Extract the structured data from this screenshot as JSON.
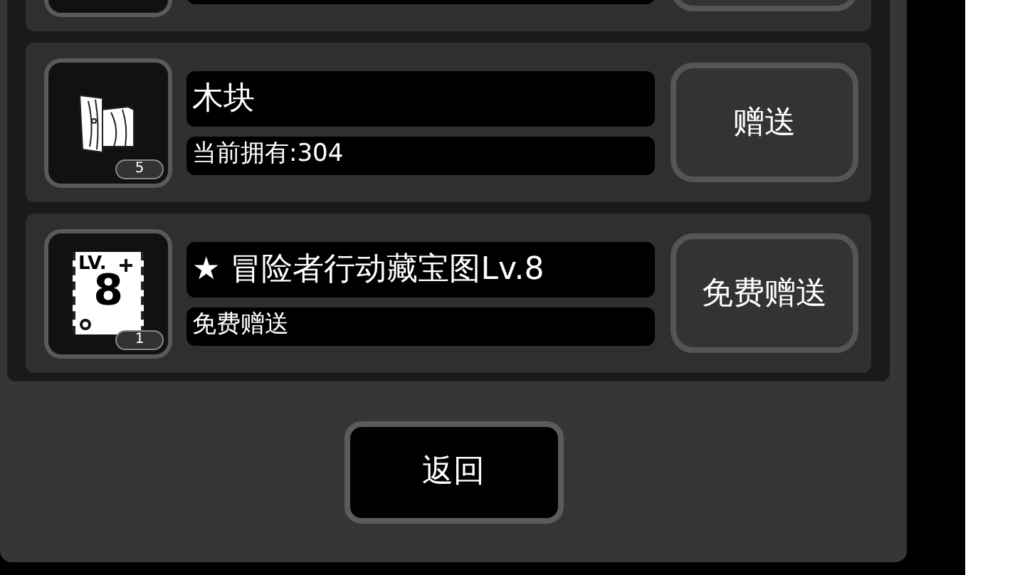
{
  "items": [
    {
      "kind": "wood",
      "badge": "5",
      "name": "木块",
      "subtitle": "当前拥有:304",
      "button": "赠送"
    },
    {
      "kind": "map",
      "icon_label": "LV.",
      "icon_number": "8",
      "badge": "1",
      "name": "★ 冒险者行动藏宝图Lv.8",
      "subtitle": "免费赠送",
      "button": "免费赠送"
    }
  ],
  "back_button": "返回"
}
